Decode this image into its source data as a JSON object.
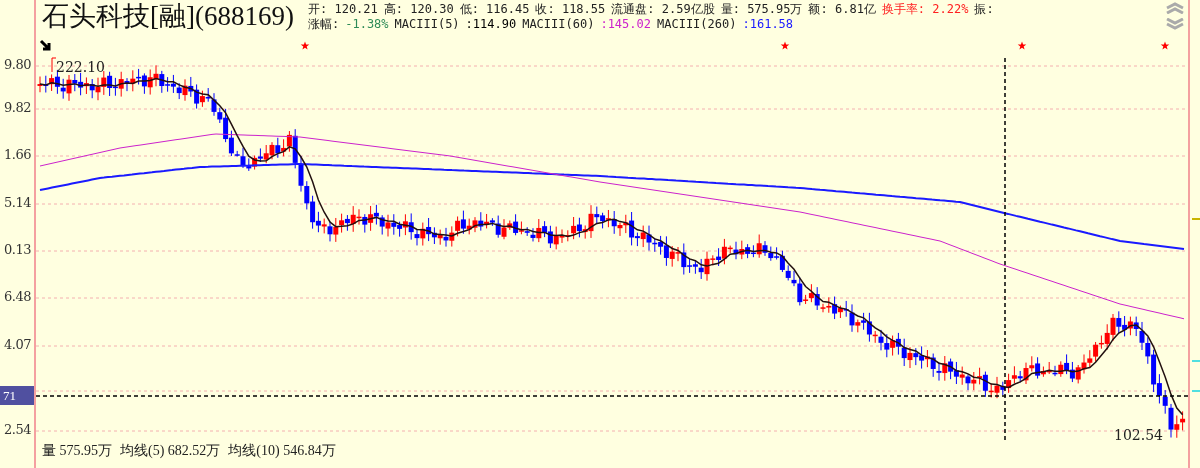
{
  "title": "石头科技[融](688169)",
  "quote_fields": [
    {
      "label": "开:",
      "value": "120.21"
    },
    {
      "label": "高:",
      "value": "120.30"
    },
    {
      "label": "低:",
      "value": "116.45"
    },
    {
      "label": "收:",
      "value": "118.55"
    },
    {
      "label": "流通盘:",
      "value": "2.59亿股"
    },
    {
      "label": "量:",
      "value": "575.95万"
    },
    {
      "label": "额:",
      "value": "6.81亿"
    }
  ],
  "turnover": {
    "label": "换手率:",
    "value": "2.22%"
  },
  "amplitude_label": "振:",
  "change": {
    "label": "涨幅:",
    "value": "-1.38%"
  },
  "moving_averages": [
    {
      "label": "MACIII(5)",
      "value": ":114.90",
      "color": "#000000"
    },
    {
      "label": "MACIII(60)",
      "value": ":145.02",
      "color": "#cc22cc"
    },
    {
      "label": "MACIII(260)",
      "value": ":161.58",
      "color": "#1a1aff"
    }
  ],
  "y_axis_labels": [
    "9.80",
    "9.82",
    "1.66",
    "5.14",
    "0.13",
    "6.48",
    "4.07",
    "2.54"
  ],
  "crosshair_label": "71",
  "high_label": "222.10",
  "low_label": "102.54",
  "volume_line": [
    {
      "label": "量",
      "value": "575.95万"
    },
    {
      "label": "均线(5)",
      "value": "682.52万"
    },
    {
      "label": "均线(10)",
      "value": "546.84万"
    }
  ]
}
